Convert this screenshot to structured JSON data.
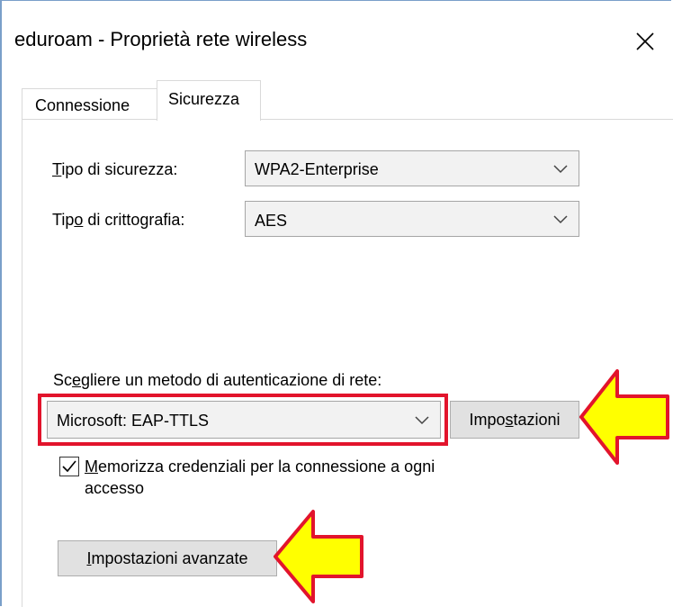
{
  "window": {
    "title": "eduroam - Proprietà rete wireless",
    "close_glyph": "✕"
  },
  "tabs": [
    {
      "label": "Connessione",
      "selected": false
    },
    {
      "label": "Sicurezza",
      "selected": true
    }
  ],
  "security_type": {
    "label_u": "T",
    "label_rest": "ipo di sicurezza:",
    "value": "WPA2-Enterprise"
  },
  "encryption_type": {
    "label_pre": "Tip",
    "label_u": "o",
    "label_rest": " di crittografia:",
    "value": "AES"
  },
  "auth_method": {
    "label_pre": "Sc",
    "label_u": "e",
    "label_rest": "gliere un metodo di autenticazione di rete:",
    "value": "Microsoft: EAP-TTLS"
  },
  "settings_button": {
    "label_pre": "Impo",
    "label_u": "s",
    "label_rest": "tazioni"
  },
  "remember_credentials": {
    "checked": true,
    "line1_pre": "",
    "line1_u": "M",
    "line1_rest": "emorizza credenziali per la connessione a ogni",
    "line2": "accesso"
  },
  "advanced_button": {
    "label_u": "I",
    "label_rest": "mpostazioni avanzate"
  },
  "annotations": {
    "highlight_color": "#e2142c",
    "arrow_fill": "#ffff00",
    "arrow_stroke": "#e2142c"
  }
}
